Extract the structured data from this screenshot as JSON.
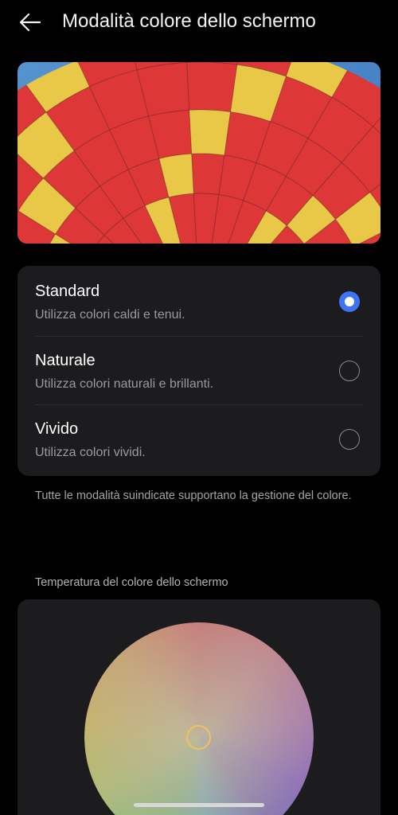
{
  "header": {
    "title": "Modalità colore dello schermo",
    "back_icon": "arrow-left-icon"
  },
  "preview": {
    "description_icon": "hot-air-balloon-image"
  },
  "modes": [
    {
      "name": "Standard",
      "description": "Utilizza colori caldi e tenui.",
      "selected": true
    },
    {
      "name": "Naturale",
      "description": "Utilizza colori naturali e brillanti.",
      "selected": false
    },
    {
      "name": "Vivido",
      "description": "Utilizza colori vividi.",
      "selected": false
    }
  ],
  "note": "Tutte le modalità suindicate supportano la gestione del colore.",
  "temperature": {
    "label": "Temperatura del colore dello schermo"
  },
  "colors": {
    "background": "#000000",
    "card": "#1c1c1e",
    "accent": "#3f73f6",
    "thumb": "#f0c15c"
  }
}
